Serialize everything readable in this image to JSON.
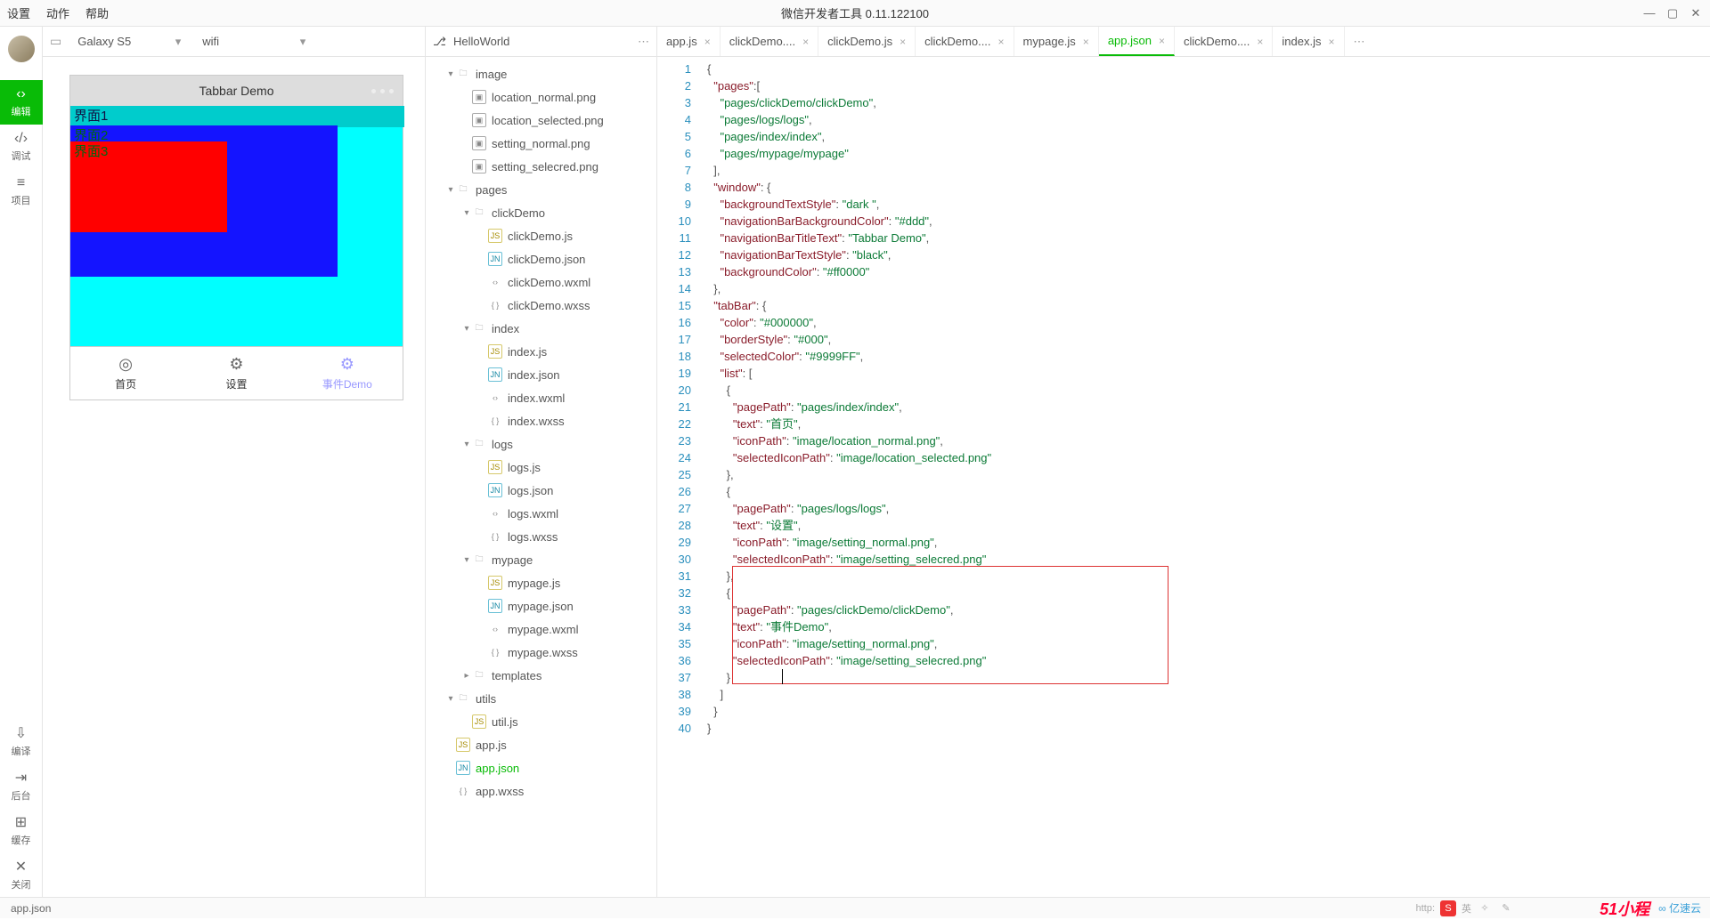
{
  "menubar": {
    "items": [
      "设置",
      "动作",
      "帮助"
    ],
    "title": "微信开发者工具 0.11.122100"
  },
  "leftRail": {
    "items": [
      {
        "label": "编辑",
        "icon": "‹›"
      },
      {
        "label": "调试",
        "icon": "‹/›"
      },
      {
        "label": "项目",
        "icon": "≡"
      }
    ],
    "bottom": [
      {
        "label": "编译",
        "icon": "⇩"
      },
      {
        "label": "后台",
        "icon": "⇥"
      },
      {
        "label": "缓存",
        "icon": "⊞"
      },
      {
        "label": "关闭",
        "icon": "✕"
      }
    ]
  },
  "simToolbar": {
    "device": "Galaxy S5",
    "network": "wifi"
  },
  "phone": {
    "title": "Tabbar Demo",
    "layers": [
      "界面1",
      "界面2",
      "界面3"
    ],
    "tabs": [
      {
        "label": "首页",
        "icon": "◎"
      },
      {
        "label": "设置",
        "icon": "⚙"
      },
      {
        "label": "事件Demo",
        "icon": "⚙"
      }
    ]
  },
  "treeHead": {
    "project": "HelloWorld"
  },
  "tree": [
    {
      "d": 1,
      "t": "f",
      "ic": "fold",
      "arr": "▾",
      "label": "image"
    },
    {
      "d": 2,
      "t": "l",
      "ic": "img",
      "label": "location_normal.png"
    },
    {
      "d": 2,
      "t": "l",
      "ic": "img",
      "label": "location_selected.png"
    },
    {
      "d": 2,
      "t": "l",
      "ic": "img",
      "label": "setting_normal.png"
    },
    {
      "d": 2,
      "t": "l",
      "ic": "img",
      "label": "setting_selecred.png"
    },
    {
      "d": 1,
      "t": "f",
      "ic": "fold",
      "arr": "▾",
      "label": "pages"
    },
    {
      "d": 2,
      "t": "f",
      "ic": "fold",
      "arr": "▾",
      "label": "clickDemo"
    },
    {
      "d": 3,
      "t": "l",
      "ic": "js",
      "label": "clickDemo.js"
    },
    {
      "d": 3,
      "t": "l",
      "ic": "json",
      "label": "clickDemo.json"
    },
    {
      "d": 3,
      "t": "l",
      "ic": "wxml",
      "label": "clickDemo.wxml"
    },
    {
      "d": 3,
      "t": "l",
      "ic": "wxss",
      "label": "clickDemo.wxss"
    },
    {
      "d": 2,
      "t": "f",
      "ic": "fold",
      "arr": "▾",
      "label": "index"
    },
    {
      "d": 3,
      "t": "l",
      "ic": "js",
      "label": "index.js"
    },
    {
      "d": 3,
      "t": "l",
      "ic": "json",
      "label": "index.json"
    },
    {
      "d": 3,
      "t": "l",
      "ic": "wxml",
      "label": "index.wxml"
    },
    {
      "d": 3,
      "t": "l",
      "ic": "wxss",
      "label": "index.wxss"
    },
    {
      "d": 2,
      "t": "f",
      "ic": "fold",
      "arr": "▾",
      "label": "logs"
    },
    {
      "d": 3,
      "t": "l",
      "ic": "js",
      "label": "logs.js"
    },
    {
      "d": 3,
      "t": "l",
      "ic": "json",
      "label": "logs.json"
    },
    {
      "d": 3,
      "t": "l",
      "ic": "wxml",
      "label": "logs.wxml"
    },
    {
      "d": 3,
      "t": "l",
      "ic": "wxss",
      "label": "logs.wxss"
    },
    {
      "d": 2,
      "t": "f",
      "ic": "fold",
      "arr": "▾",
      "label": "mypage"
    },
    {
      "d": 3,
      "t": "l",
      "ic": "js",
      "label": "mypage.js"
    },
    {
      "d": 3,
      "t": "l",
      "ic": "json",
      "label": "mypage.json"
    },
    {
      "d": 3,
      "t": "l",
      "ic": "wxml",
      "label": "mypage.wxml"
    },
    {
      "d": 3,
      "t": "l",
      "ic": "wxss",
      "label": "mypage.wxss"
    },
    {
      "d": 2,
      "t": "f",
      "ic": "fold",
      "arr": "▸",
      "label": "templates"
    },
    {
      "d": 1,
      "t": "f",
      "ic": "fold",
      "arr": "▾",
      "label": "utils"
    },
    {
      "d": 2,
      "t": "l",
      "ic": "js",
      "label": "util.js"
    },
    {
      "d": 1,
      "t": "l",
      "ic": "js",
      "label": "app.js"
    },
    {
      "d": 1,
      "t": "l",
      "ic": "json",
      "label": "app.json",
      "active": true
    },
    {
      "d": 1,
      "t": "l",
      "ic": "wxss",
      "label": "app.wxss"
    }
  ],
  "editorTabs": [
    {
      "label": "app.js"
    },
    {
      "label": "clickDemo...."
    },
    {
      "label": "clickDemo.js"
    },
    {
      "label": "clickDemo...."
    },
    {
      "label": "mypage.js"
    },
    {
      "label": "app.json",
      "active": true
    },
    {
      "label": "clickDemo...."
    },
    {
      "label": "index.js"
    }
  ],
  "code": [
    [
      [
        "p",
        "{"
      ]
    ],
    [
      [
        "p",
        "  "
      ],
      [
        "k",
        "\"pages\""
      ],
      [
        "p",
        ":["
      ]
    ],
    [
      [
        "p",
        "    "
      ],
      [
        "s",
        "\"pages/clickDemo/clickDemo\""
      ],
      [
        "p",
        ","
      ]
    ],
    [
      [
        "p",
        "    "
      ],
      [
        "s",
        "\"pages/logs/logs\""
      ],
      [
        "p",
        ","
      ]
    ],
    [
      [
        "p",
        "    "
      ],
      [
        "s",
        "\"pages/index/index\""
      ],
      [
        "p",
        ","
      ]
    ],
    [
      [
        "p",
        "    "
      ],
      [
        "s",
        "\"pages/mypage/mypage\""
      ]
    ],
    [
      [
        "p",
        "  ],"
      ]
    ],
    [
      [
        "p",
        "  "
      ],
      [
        "k",
        "\"window\""
      ],
      [
        "p",
        ": {"
      ]
    ],
    [
      [
        "p",
        "    "
      ],
      [
        "k",
        "\"backgroundTextStyle\""
      ],
      [
        "p",
        ": "
      ],
      [
        "s",
        "\"dark \""
      ],
      [
        "p",
        ","
      ]
    ],
    [
      [
        "p",
        "    "
      ],
      [
        "k",
        "\"navigationBarBackgroundColor\""
      ],
      [
        "p",
        ": "
      ],
      [
        "s",
        "\"#ddd\""
      ],
      [
        "p",
        ","
      ]
    ],
    [
      [
        "p",
        "    "
      ],
      [
        "k",
        "\"navigationBarTitleText\""
      ],
      [
        "p",
        ": "
      ],
      [
        "s",
        "\"Tabbar Demo\""
      ],
      [
        "p",
        ","
      ]
    ],
    [
      [
        "p",
        "    "
      ],
      [
        "k",
        "\"navigationBarTextStyle\""
      ],
      [
        "p",
        ": "
      ],
      [
        "s",
        "\"black\""
      ],
      [
        "p",
        ","
      ]
    ],
    [
      [
        "p",
        "    "
      ],
      [
        "k",
        "\"backgroundColor\""
      ],
      [
        "p",
        ": "
      ],
      [
        "s",
        "\"#ff0000\""
      ]
    ],
    [
      [
        "p",
        "  },"
      ]
    ],
    [
      [
        "p",
        "  "
      ],
      [
        "k",
        "\"tabBar\""
      ],
      [
        "p",
        ": {"
      ]
    ],
    [
      [
        "p",
        "    "
      ],
      [
        "k",
        "\"color\""
      ],
      [
        "p",
        ": "
      ],
      [
        "s",
        "\"#000000\""
      ],
      [
        "p",
        ","
      ]
    ],
    [
      [
        "p",
        "    "
      ],
      [
        "k",
        "\"borderStyle\""
      ],
      [
        "p",
        ": "
      ],
      [
        "s",
        "\"#000\""
      ],
      [
        "p",
        ","
      ]
    ],
    [
      [
        "p",
        "    "
      ],
      [
        "k",
        "\"selectedColor\""
      ],
      [
        "p",
        ": "
      ],
      [
        "s",
        "\"#9999FF\""
      ],
      [
        "p",
        ","
      ]
    ],
    [
      [
        "p",
        "    "
      ],
      [
        "k",
        "\"list\""
      ],
      [
        "p",
        ": ["
      ]
    ],
    [
      [
        "p",
        "      {"
      ]
    ],
    [
      [
        "p",
        "        "
      ],
      [
        "k",
        "\"pagePath\""
      ],
      [
        "p",
        ": "
      ],
      [
        "s",
        "\"pages/index/index\""
      ],
      [
        "p",
        ","
      ]
    ],
    [
      [
        "p",
        "        "
      ],
      [
        "k",
        "\"text\""
      ],
      [
        "p",
        ": "
      ],
      [
        "s",
        "\"首页\""
      ],
      [
        "p",
        ","
      ]
    ],
    [
      [
        "p",
        "        "
      ],
      [
        "k",
        "\"iconPath\""
      ],
      [
        "p",
        ": "
      ],
      [
        "s",
        "\"image/location_normal.png\""
      ],
      [
        "p",
        ","
      ]
    ],
    [
      [
        "p",
        "        "
      ],
      [
        "k",
        "\"selectedIconPath\""
      ],
      [
        "p",
        ": "
      ],
      [
        "s",
        "\"image/location_selected.png\""
      ]
    ],
    [
      [
        "p",
        "      },"
      ]
    ],
    [
      [
        "p",
        "      {"
      ]
    ],
    [
      [
        "p",
        "        "
      ],
      [
        "k",
        "\"pagePath\""
      ],
      [
        "p",
        ": "
      ],
      [
        "s",
        "\"pages/logs/logs\""
      ],
      [
        "p",
        ","
      ]
    ],
    [
      [
        "p",
        "        "
      ],
      [
        "k",
        "\"text\""
      ],
      [
        "p",
        ": "
      ],
      [
        "s",
        "\"设置\""
      ],
      [
        "p",
        ","
      ]
    ],
    [
      [
        "p",
        "        "
      ],
      [
        "k",
        "\"iconPath\""
      ],
      [
        "p",
        ": "
      ],
      [
        "s",
        "\"image/setting_normal.png\""
      ],
      [
        "p",
        ","
      ]
    ],
    [
      [
        "p",
        "        "
      ],
      [
        "k",
        "\"selectedIconPath\""
      ],
      [
        "p",
        ": "
      ],
      [
        "s",
        "\"image/setting_selecred.png\""
      ]
    ],
    [
      [
        "p",
        "      },"
      ]
    ],
    [
      [
        "p",
        "      {"
      ]
    ],
    [
      [
        "p",
        "        "
      ],
      [
        "k",
        "\"pagePath\""
      ],
      [
        "p",
        ": "
      ],
      [
        "s",
        "\"pages/clickDemo/clickDemo\""
      ],
      [
        "p",
        ","
      ]
    ],
    [
      [
        "p",
        "        "
      ],
      [
        "k",
        "\"text\""
      ],
      [
        "p",
        ": "
      ],
      [
        "s",
        "\"事件Demo\""
      ],
      [
        "p",
        ","
      ]
    ],
    [
      [
        "p",
        "        "
      ],
      [
        "k",
        "\"iconPath\""
      ],
      [
        "p",
        ": "
      ],
      [
        "s",
        "\"image/setting_normal.png\""
      ],
      [
        "p",
        ","
      ]
    ],
    [
      [
        "p",
        "        "
      ],
      [
        "k",
        "\"selectedIconPath\""
      ],
      [
        "p",
        ": "
      ],
      [
        "s",
        "\"image/setting_selecred.png\""
      ]
    ],
    [
      [
        "p",
        "      }"
      ]
    ],
    [
      [
        "p",
        "    ]"
      ]
    ],
    [
      [
        "p",
        "  }"
      ]
    ],
    [
      [
        "p",
        "}"
      ]
    ]
  ],
  "status": {
    "file": "app.json"
  },
  "logos": {
    "a": "51小程",
    "b": "亿速云"
  },
  "taskbar": {
    "url": "http:",
    "ime": "英"
  }
}
